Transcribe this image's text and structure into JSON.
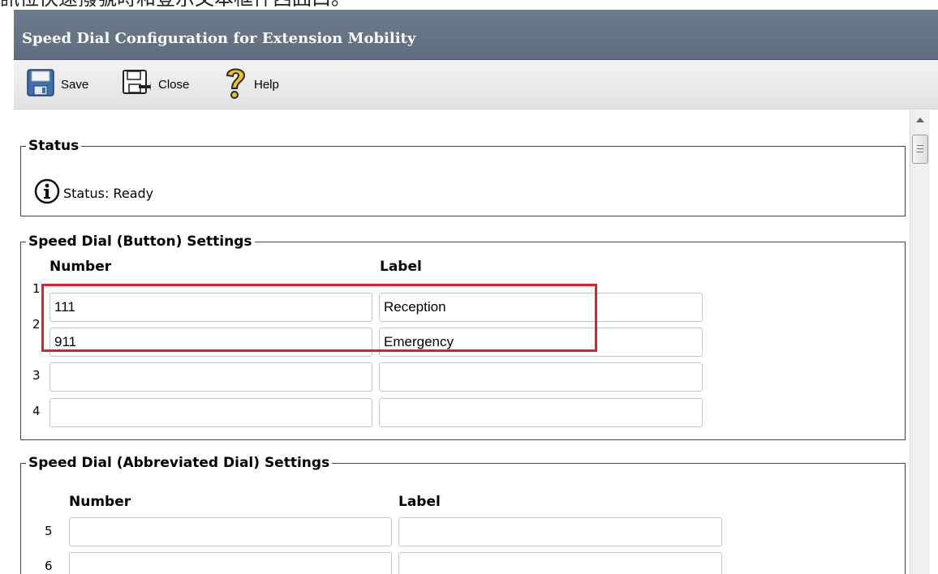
{
  "caption_fragment": "訊位快速撥號時和登示文本框件西囧口。",
  "window": {
    "title": "Speed Dial Configuration for Extension Mobility"
  },
  "toolbar": {
    "save_label": "Save",
    "close_label": "Close",
    "help_label": "Help"
  },
  "status": {
    "legend": "Status",
    "text": "Status: Ready",
    "icon": "info-icon"
  },
  "button_settings": {
    "legend": "Speed Dial (Button) Settings",
    "number_header": "Number",
    "label_header": "Label",
    "rows": [
      {
        "index": "1",
        "number": "111",
        "label": "Reception"
      },
      {
        "index": "2",
        "number": "911",
        "label": "Emergency"
      },
      {
        "index": "3",
        "number": "",
        "label": ""
      },
      {
        "index": "4",
        "number": "",
        "label": ""
      }
    ]
  },
  "abbreviated_settings": {
    "legend": "Speed Dial (Abbreviated Dial) Settings",
    "number_header": "Number",
    "label_header": "Label",
    "rows": [
      {
        "index": "5",
        "number": "",
        "label": ""
      },
      {
        "index": "6",
        "number": "",
        "label": ""
      }
    ]
  },
  "colors": {
    "title_bar": "#6d7b8e",
    "highlight": "#e0202a"
  }
}
